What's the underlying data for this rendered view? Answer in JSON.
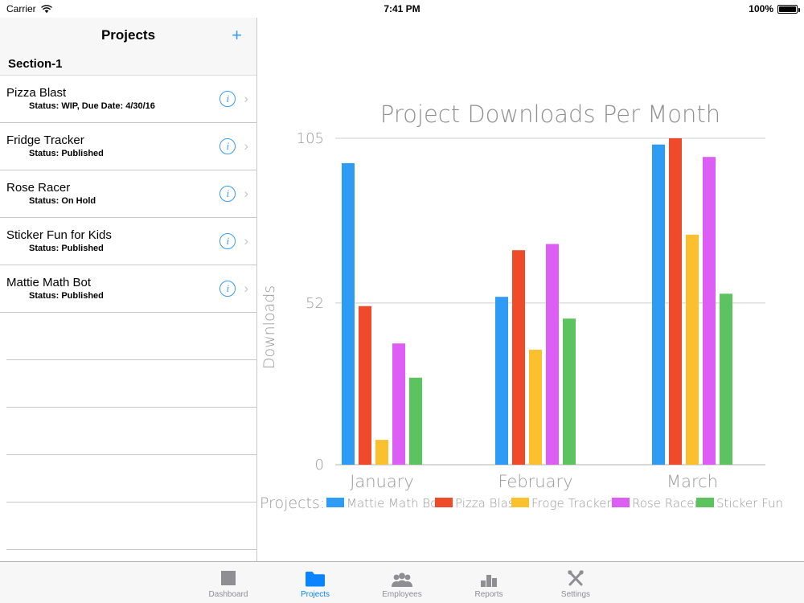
{
  "status_bar": {
    "carrier": "Carrier",
    "wifi_icon": "wifi-icon",
    "time": "7:41 PM",
    "battery_percent": "100%",
    "battery_icon": "battery-full-icon"
  },
  "sidebar": {
    "title": "Projects",
    "add_button": "+",
    "section_header": "Section-1",
    "info_glyph": "i",
    "chevron_glyph": "›",
    "items": [
      {
        "name": "Pizza Blast",
        "status": "Status: WIP, Due Date: 4/30/16"
      },
      {
        "name": "Fridge Tracker",
        "status": "Status: Published"
      },
      {
        "name": "Rose Racer",
        "status": "Status: On Hold"
      },
      {
        "name": "Sticker Fun for Kids",
        "status": "Status: Published"
      },
      {
        "name": "Mattie Math Bot",
        "status": "Status: Published"
      }
    ],
    "empty_row_count": 5
  },
  "tab_bar": {
    "tabs": [
      {
        "label": "Dashboard",
        "icon": "dashboard-square-icon",
        "active": false
      },
      {
        "label": "Projects",
        "icon": "folder-icon",
        "active": true
      },
      {
        "label": "Employees",
        "icon": "people-group-icon",
        "active": false
      },
      {
        "label": "Reports",
        "icon": "bar-chart-icon",
        "active": false
      },
      {
        "label": "Settings",
        "icon": "tools-wrench-screwdriver-icon",
        "active": false
      }
    ],
    "active_color": "#0a84ff",
    "inactive_color": "#8e8e93"
  },
  "chart_data": {
    "type": "bar",
    "title": "Project Downloads Per Month",
    "xlabel": "",
    "ylabel": "Downloads",
    "categories": [
      "January",
      "February",
      "March"
    ],
    "ylim": [
      0,
      105
    ],
    "yticks": [
      0,
      52,
      105
    ],
    "ytick_labels": [
      "0",
      "52",
      "105"
    ],
    "grid": true,
    "legend_position": "bottom",
    "legend_title": "Projects:",
    "series": [
      {
        "name": "Mattie Math Bot",
        "color": "#2e9bf5",
        "values": [
          97,
          54,
          103
        ]
      },
      {
        "name": "Pizza Blast",
        "color": "#ef4a2a",
        "values": [
          51,
          69,
          105
        ]
      },
      {
        "name": "Froge Tracker",
        "color": "#fbc02d",
        "values": [
          8,
          37,
          74
        ]
      },
      {
        "name": "Rose Racer",
        "color": "#dd5ef5",
        "values": [
          39,
          71,
          99
        ]
      },
      {
        "name": "Sticker Fun",
        "color": "#5cc35f",
        "values": [
          28,
          47,
          55
        ]
      }
    ],
    "axis_color": "#cccccc",
    "text_color": "#9a9a9a"
  }
}
